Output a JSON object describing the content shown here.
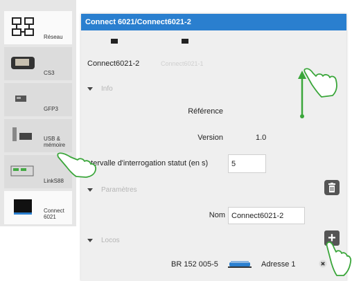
{
  "sidebar": {
    "items": [
      {
        "label": "Réseau",
        "icon": "network-icon"
      },
      {
        "label": "CS3",
        "icon": "cs3-device-icon"
      },
      {
        "label": "GFP3",
        "icon": "gfp3-device-icon"
      },
      {
        "label": "USB & mémoire",
        "icon": "usb-memory-icon"
      },
      {
        "label": "LinkS88",
        "icon": "links88-device-icon"
      },
      {
        "label": "Connect 6021",
        "icon": "connect6021-device-icon"
      }
    ]
  },
  "panel": {
    "title": "Connect 6021/Connect6021-2",
    "tabs": [
      {
        "label": "Connect6021-2",
        "active": true
      },
      {
        "label": "Connect6021-1",
        "active": false
      }
    ],
    "info": {
      "section_label": "Info",
      "reference_label": "Référence",
      "version_label": "Version",
      "version_value": "1.0",
      "poll_label": "Intervalle d'interrogation statut (en s)",
      "poll_value": "5"
    },
    "params": {
      "section_label": "Paramètres",
      "name_label": "Nom",
      "name_value": "Connect6021-2"
    },
    "locos": {
      "section_label": "Locos",
      "loco_name": "BR 152 005-5",
      "address_label": "Adresse 1"
    }
  },
  "colors": {
    "titlebar": "#2a7fcf",
    "accent_green": "#3aa63a"
  }
}
